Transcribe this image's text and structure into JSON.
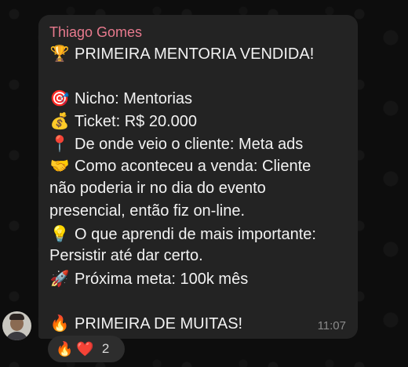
{
  "message": {
    "sender": "Thiago Gomes",
    "lines": [
      {
        "emoji": "🏆",
        "text": "PRIMEIRA MENTORIA VENDIDA!"
      },
      {
        "emoji": "",
        "text": ""
      },
      {
        "emoji": "🎯",
        "text": "Nicho: Mentorias"
      },
      {
        "emoji": "💰",
        "text": "Ticket: R$ 20.000"
      },
      {
        "emoji": "📍",
        "text": "De onde veio o cliente: Meta ads"
      },
      {
        "emoji": "🤝",
        "text": "Como aconteceu a venda: Cliente"
      },
      {
        "emoji": "",
        "text": "não poderia ir no dia do evento"
      },
      {
        "emoji": "",
        "text": "presencial, então fiz on-line."
      },
      {
        "emoji": "💡",
        "text": "O que aprendi de mais importante:"
      },
      {
        "emoji": "",
        "text": "Persistir até dar certo."
      },
      {
        "emoji": "🚀",
        "text": "Próxima meta: 100k mês"
      },
      {
        "emoji": "",
        "text": ""
      },
      {
        "emoji": "🔥",
        "text": "PRIMEIRA DE MUITAS!"
      }
    ],
    "time": "11:07"
  },
  "reactions": {
    "emojis": [
      "🔥",
      "❤️"
    ],
    "count": "2"
  },
  "colors": {
    "sender": "#e87a8e",
    "bubble": "#232323",
    "background": "#0d0d0d"
  },
  "icons": {
    "avatar": "user-avatar-photo"
  }
}
